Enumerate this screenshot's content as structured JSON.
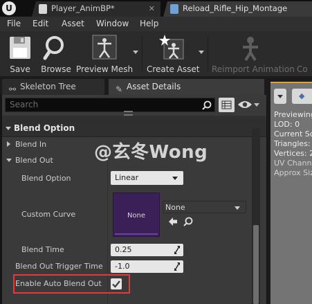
{
  "title_bar": {
    "tabs": [
      {
        "label": "Player_AnimBP*"
      },
      {
        "label": "Reload_Rifle_Hip_Montage"
      }
    ],
    "logo_letter": "U"
  },
  "menu": [
    "File",
    "Edit",
    "Asset",
    "Window",
    "Help"
  ],
  "toolbar": {
    "save": "Save",
    "browse": "Browse",
    "preview_mesh": "Preview Mesh",
    "create_asset": "Create Asset",
    "reimport_animation": "Reimport Animation",
    "cut_off": "Co"
  },
  "panel_tabs": {
    "skeleton_tree": "Skeleton Tree",
    "asset_details": "Asset Details"
  },
  "search": {
    "placeholder": "Search",
    "value": ""
  },
  "details": {
    "category": "Blend Option",
    "blend_in": "Blend In",
    "blend_out": "Blend Out",
    "rows": {
      "blend_option": {
        "label": "Blend Option",
        "value": "Linear"
      },
      "custom_curve": {
        "label": "Custom Curve",
        "thumb_text": "None",
        "value": "None"
      },
      "blend_time": {
        "label": "Blend Time",
        "value": "0.25"
      },
      "trigger_time": {
        "label": "Blend Out Trigger Time",
        "value": "-1.0"
      },
      "auto_blend_out": {
        "label": "Enable Auto Blend Out",
        "checked": true
      }
    }
  },
  "viewport": {
    "lines": [
      "Previewing",
      "LOD: 0",
      "Current Sc",
      "Triangles:",
      "Vertices: 2",
      "UV Chann",
      "Approx Siz"
    ],
    "accent_color": "#e1a23a"
  },
  "watermark": "@玄冬Wong",
  "colors": {
    "highlight": "#e33b3b",
    "curve_background": "#3b1f57"
  }
}
